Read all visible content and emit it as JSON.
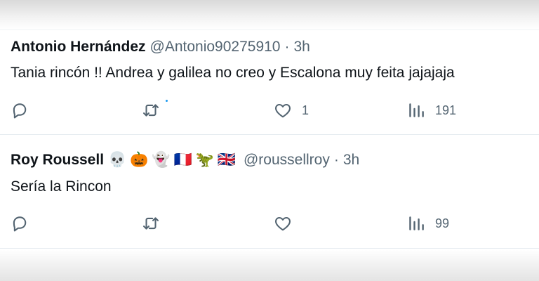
{
  "replies": [
    {
      "author_name": "Antonio Hernández",
      "emojis": [],
      "handle": "@Antonio90275910",
      "separator": "·",
      "time": "3h",
      "text": "Tania rincón !! Andrea y galilea no creo y Escalona muy feita jajajaja",
      "actions": {
        "reply_count": "",
        "retweet_count": "",
        "like_count": "1",
        "view_count": "191"
      }
    },
    {
      "author_name": "Roy Roussell",
      "emojis": [
        "💀",
        "🎃",
        "👻",
        "🇫🇷",
        "🦖",
        "🇬🇧"
      ],
      "handle": "@roussellroy",
      "separator": "·",
      "time": "3h",
      "text": "Sería la Rincon",
      "actions": {
        "reply_count": "",
        "retweet_count": "",
        "like_count": "",
        "view_count": "99"
      }
    }
  ],
  "colors": {
    "text": "#0f1419",
    "secondary": "#536471",
    "accent": "#1d9bf0",
    "divider": "#e6ecf0"
  },
  "icons": [
    "reply-icon",
    "retweet-icon",
    "like-icon",
    "views-icon"
  ]
}
